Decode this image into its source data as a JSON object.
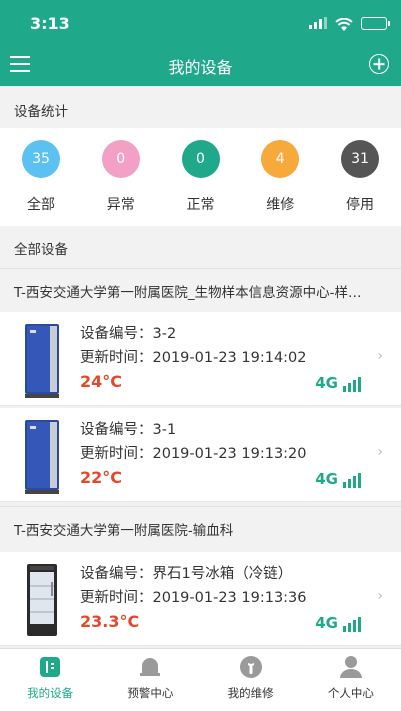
{
  "status_bar": {
    "time": "3:13"
  },
  "header": {
    "title": "我的设备",
    "menu_icon": "menu-icon",
    "add_icon": "plus-circle-icon"
  },
  "stats_section": {
    "label": "设备统计",
    "items": [
      {
        "value": "35",
        "label": "全部",
        "color": "#5bc1f0"
      },
      {
        "value": "0",
        "label": "异常",
        "color": "#f3a0c7"
      },
      {
        "value": "0",
        "label": "正常",
        "color": "#1fa88a"
      },
      {
        "value": "4",
        "label": "维修",
        "color": "#f7a93c"
      },
      {
        "value": "31",
        "label": "停用",
        "color": "#555555"
      }
    ]
  },
  "devices_section": {
    "label": "全部设备",
    "groups": [
      {
        "title": "T-西安交通大学第一附属医院_生物样本信息资源中心-样…",
        "devices": [
          {
            "number_label": "设备编号：",
            "number": "3-2",
            "time_label": "更新时间：",
            "time": "2019-01-23 19:14:02",
            "temp": "24°C",
            "network": "4G",
            "image": "ultra-low-freezer"
          },
          {
            "number_label": "设备编号：",
            "number": "3-1",
            "time_label": "更新时间：",
            "time": "2019-01-23 19:13:20",
            "temp": "22°C",
            "network": "4G",
            "image": "ultra-low-freezer"
          }
        ]
      },
      {
        "title": "T-西安交通大学第一附属医院-输血科",
        "devices": [
          {
            "number_label": "设备编号：",
            "number": "界石1号冰箱（冷链）",
            "time_label": "更新时间：",
            "time": "2019-01-23 19:13:36",
            "temp": "23.3°C",
            "network": "4G",
            "image": "glass-door-refrigerator"
          }
        ]
      }
    ]
  },
  "tabbar": {
    "tabs": [
      {
        "label": "我的设备",
        "icon": "device-icon",
        "active": true
      },
      {
        "label": "预警中心",
        "icon": "bell-icon",
        "active": false
      },
      {
        "label": "我的维修",
        "icon": "wrench-icon",
        "active": false
      },
      {
        "label": "个人中心",
        "icon": "person-icon",
        "active": false
      }
    ],
    "active_color": "#1fa88a"
  },
  "colors": {
    "brand": "#1fa88a",
    "temperature": "#e2492a"
  }
}
